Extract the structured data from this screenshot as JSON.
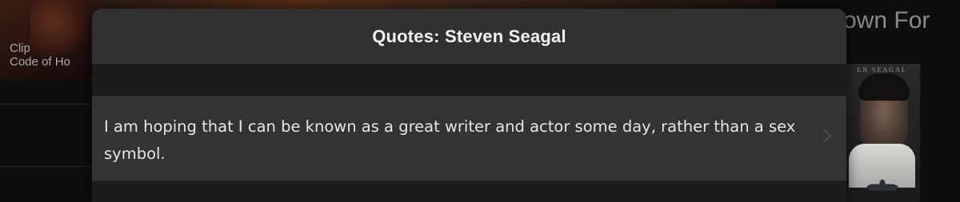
{
  "background": {
    "clip": {
      "label": "Clip",
      "title": "Code of Ho"
    },
    "section_title": "own For",
    "poster_name": "EN SEAGAL"
  },
  "modal": {
    "title": "Quotes: Steven Seagal",
    "quotes": [
      {
        "text": "I am hoping that I can be known as a great writer and actor some day, rather than a sex symbol."
      }
    ]
  },
  "icons": {
    "row_disclosure": "chevron-right-icon"
  },
  "colors": {
    "modal_header_bg": "#313131",
    "modal_body_bg": "#1c1c1c",
    "quote_row_bg": "#333333",
    "title_text": "#f2f2f2",
    "quote_text": "#e6e6e6"
  }
}
